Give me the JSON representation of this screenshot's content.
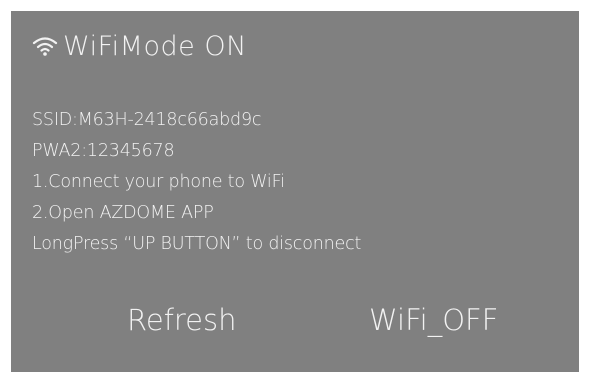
{
  "header": {
    "icon": "wifi-icon",
    "title": "WiFiMode ON"
  },
  "info": {
    "ssid": "SSID:M63H-2418c66abd9c",
    "password": "PWA2:12345678",
    "step1": "1.Connect your phone to WiFi",
    "step2": "2.Open AZDOME APP",
    "hint": "LongPress “UP BUTTON” to disconnect"
  },
  "buttons": {
    "refresh": "Refresh",
    "wifi_off": "WiFi_OFF"
  },
  "colors": {
    "screen_bg": "#808080",
    "text": "#f2f2f2"
  }
}
